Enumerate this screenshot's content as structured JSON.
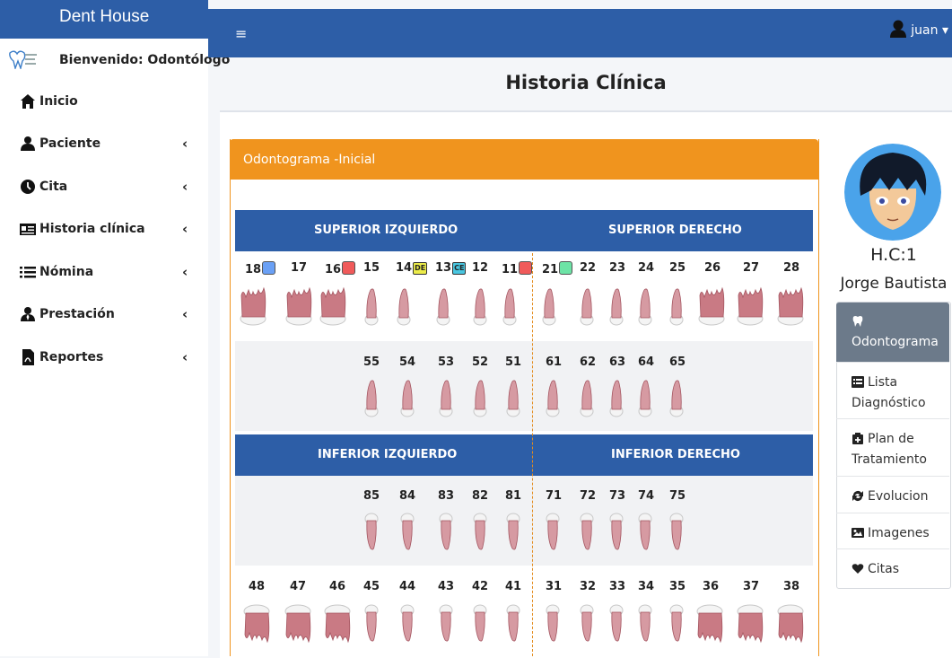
{
  "brand": "Dent House",
  "welcome": "Bienvenido: Odontólogo",
  "nav": [
    {
      "label": "Inicio",
      "icon": "home-icon"
    },
    {
      "label": "Paciente",
      "icon": "user-icon"
    },
    {
      "label": "Cita",
      "icon": "clock-icon"
    },
    {
      "label": "Historia clínica",
      "icon": "id-card-icon"
    },
    {
      "label": "Nómina",
      "icon": "list-icon"
    },
    {
      "label": "Prestación",
      "icon": "user-tie-icon"
    },
    {
      "label": "Reportes",
      "icon": "pdf-file-icon"
    }
  ],
  "chevron": "‹",
  "topbar": {
    "menu_glyph": "≡",
    "user": "juan"
  },
  "page_title": "Historia Clínica",
  "odontogram": {
    "header": "Odontograma -Inicial",
    "bands": {
      "superior_izq": "SUPERIOR IZQUIERDO",
      "superior_der": "SUPERIOR DERECHO",
      "inferior_izq": "INFERIOR IZQUIERDO",
      "inferior_der": "INFERIOR DERECHO"
    },
    "rows": [
      {
        "type": "molar_up",
        "teeth": [
          {
            "n": "18",
            "mark": "blue"
          },
          {
            "n": "17"
          },
          {
            "n": "16",
            "mark": "red"
          },
          {
            "n": "15"
          },
          {
            "n": "14",
            "tag": "DE",
            "tagColor": "#ecec4a"
          },
          {
            "n": "13",
            "tag": "CE",
            "tagColor": "#49c6e0"
          },
          {
            "n": "12"
          },
          {
            "n": "11",
            "mark": "red"
          },
          {
            "n": "21",
            "mark": "green"
          },
          {
            "n": "22"
          },
          {
            "n": "23"
          },
          {
            "n": "24"
          },
          {
            "n": "25"
          },
          {
            "n": "26"
          },
          {
            "n": "27"
          },
          {
            "n": "28"
          }
        ]
      },
      {
        "type": "primary_up",
        "teeth": [
          {
            "n": "55"
          },
          {
            "n": "54"
          },
          {
            "n": "53"
          },
          {
            "n": "52"
          },
          {
            "n": "51"
          },
          {
            "n": "61"
          },
          {
            "n": "62"
          },
          {
            "n": "63"
          },
          {
            "n": "64"
          },
          {
            "n": "65"
          }
        ]
      },
      {
        "type": "primary_down",
        "teeth": [
          {
            "n": "85"
          },
          {
            "n": "84"
          },
          {
            "n": "83"
          },
          {
            "n": "82"
          },
          {
            "n": "81"
          },
          {
            "n": "71"
          },
          {
            "n": "72"
          },
          {
            "n": "73"
          },
          {
            "n": "74"
          },
          {
            "n": "75"
          }
        ]
      },
      {
        "type": "molar_down",
        "teeth": [
          {
            "n": "48"
          },
          {
            "n": "47"
          },
          {
            "n": "46"
          },
          {
            "n": "45"
          },
          {
            "n": "44"
          },
          {
            "n": "43"
          },
          {
            "n": "42"
          },
          {
            "n": "41"
          },
          {
            "n": "31"
          },
          {
            "n": "32"
          },
          {
            "n": "33"
          },
          {
            "n": "34"
          },
          {
            "n": "35"
          },
          {
            "n": "36"
          },
          {
            "n": "37"
          },
          {
            "n": "38"
          }
        ]
      }
    ]
  },
  "patient": {
    "hc": "H.C:1",
    "name": "Jorge Bautista"
  },
  "menu": [
    {
      "label": "Odontograma",
      "icon": "tooth-icon",
      "active": true
    },
    {
      "label": "Lista Diagnóstico",
      "icon": "table-list-icon"
    },
    {
      "label": "Plan de Tratamiento",
      "icon": "clipboard-icon"
    },
    {
      "label": "Evolucion",
      "icon": "sync-icon"
    },
    {
      "label": "Imagenes",
      "icon": "image-icon"
    },
    {
      "label": "Citas",
      "icon": "heart-icon"
    }
  ],
  "colors": {
    "primary": "#2d5ea7",
    "orange": "#f0941e",
    "active": "#6c7a8a",
    "red": "#f05a5a",
    "blue": "#6aa0f5",
    "green": "#6de3a6"
  }
}
